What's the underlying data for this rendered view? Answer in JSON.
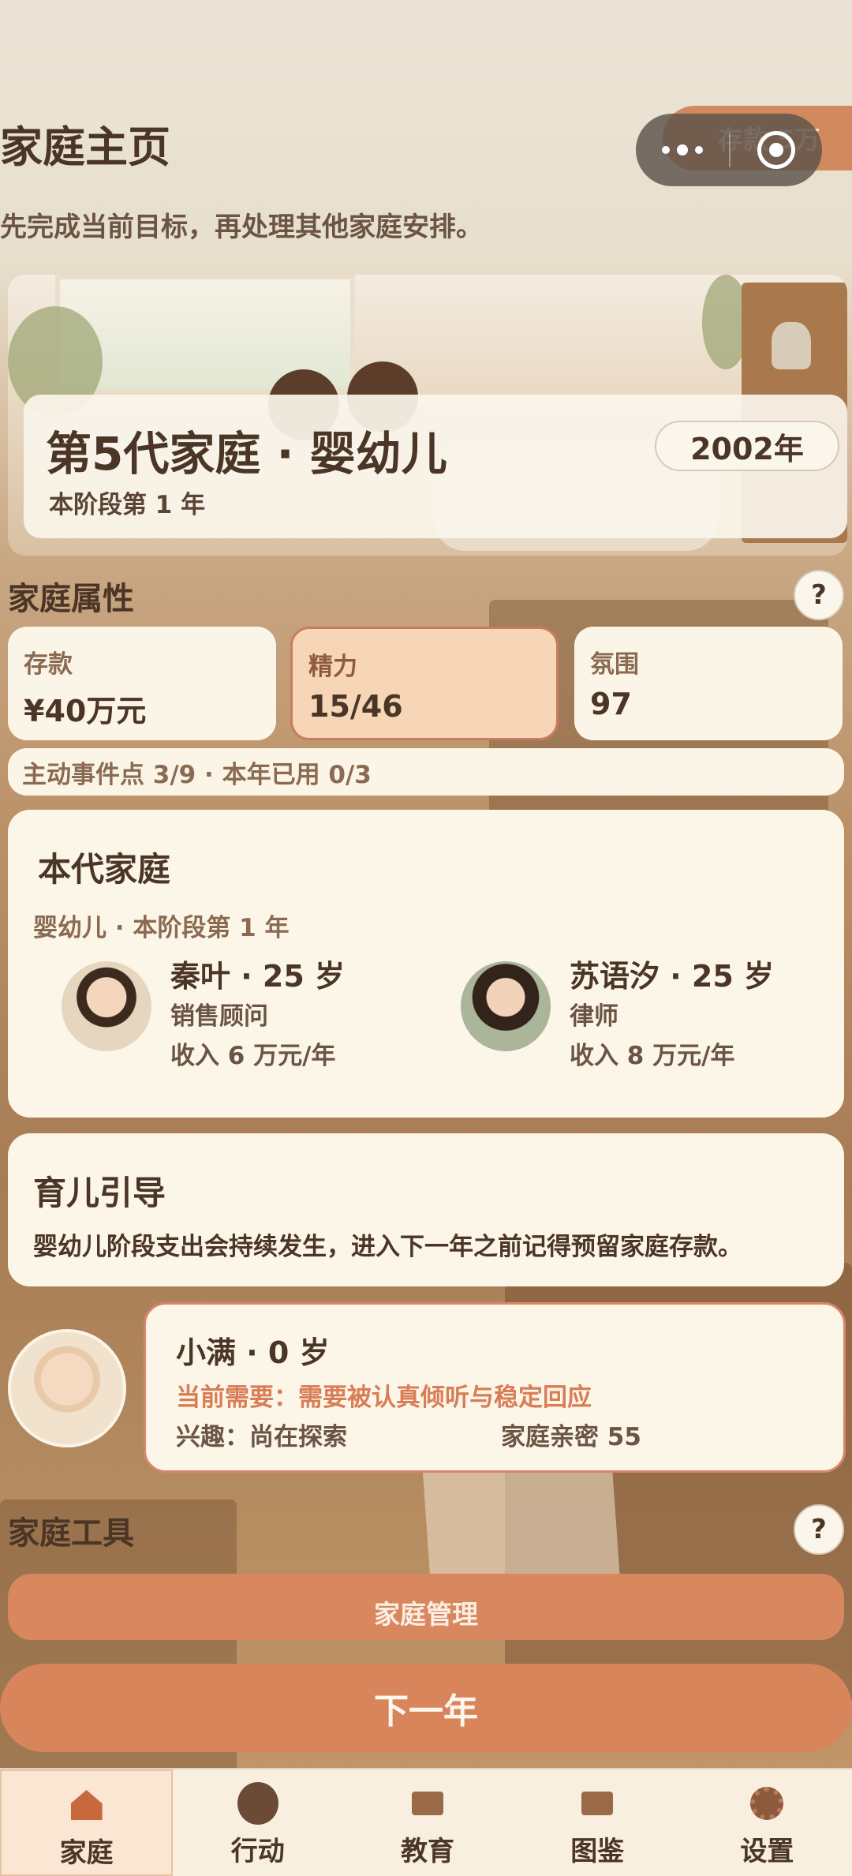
{
  "header": {
    "title": "家庭主页",
    "subtitle": "先完成当前目标，再处理其他家庭安排。",
    "savings_pill": "存款 5万"
  },
  "hero": {
    "generation": "第5代家庭 · 婴幼儿",
    "stage_year": "本阶段第 1 年",
    "year": "2002年"
  },
  "attributes": {
    "title": "家庭属性",
    "help": "?",
    "stats": [
      {
        "label": "存款",
        "value": "¥40万元"
      },
      {
        "label": "精力",
        "value": "15/46"
      },
      {
        "label": "氛围",
        "value": "97"
      }
    ],
    "events": "主动事件点 3/9 · 本年已用 0/3"
  },
  "family": {
    "title": "本代家庭",
    "stage": "婴幼儿 · 本阶段第 1 年",
    "parents": [
      {
        "name": "秦叶 · 25 岁",
        "job": "销售顾问",
        "income": "收入 6 万元/年"
      },
      {
        "name": "苏语汐 · 25 岁",
        "job": "律师",
        "income": "收入 8 万元/年"
      }
    ]
  },
  "guide": {
    "title": "育儿引导",
    "text": "婴幼儿阶段支出会持续发生，进入下一年之前记得预留家庭存款。"
  },
  "child": {
    "name": "小满 · 0 岁",
    "need": "当前需要：需要被认真倾听与稳定回应",
    "interest": "兴趣：尚在探索",
    "bond": "家庭亲密 55"
  },
  "tools": {
    "title": "家庭工具",
    "help": "?",
    "manage_label": "家庭管理",
    "next_label": "下一年"
  },
  "tabs": [
    {
      "label": "家庭",
      "icon": "house-icon"
    },
    {
      "label": "行动",
      "icon": "action-icon"
    },
    {
      "label": "教育",
      "icon": "book-icon"
    },
    {
      "label": "图鉴",
      "icon": "album-icon"
    },
    {
      "label": "设置",
      "icon": "gear-icon"
    }
  ],
  "colors": {
    "accent": "#d8855b",
    "text": "#4a3526",
    "card": "#fcf6e9",
    "need": "#d87d55"
  }
}
